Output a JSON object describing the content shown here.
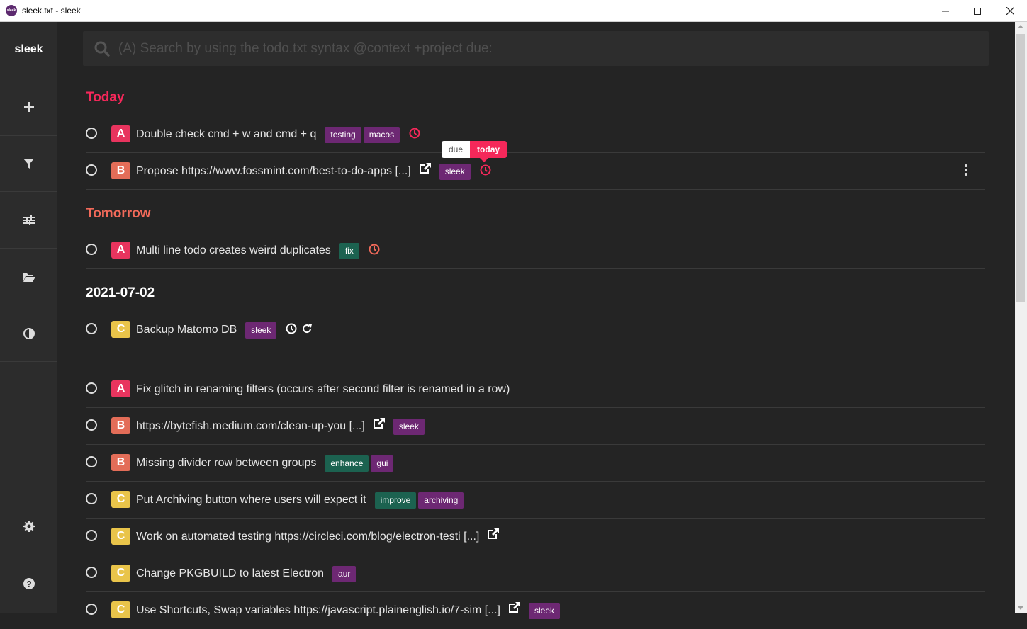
{
  "window": {
    "title": "sleek.txt - sleek",
    "app_icon_text": "sleek"
  },
  "sidebar": {
    "logo": "sleek",
    "items": [
      {
        "icon": "plus-icon"
      },
      {
        "icon": "filter-icon"
      },
      {
        "icon": "sliders-icon"
      },
      {
        "icon": "folder-open-icon"
      },
      {
        "icon": "contrast-icon"
      },
      {
        "icon": "gear-icon"
      },
      {
        "icon": "help-icon"
      }
    ]
  },
  "search": {
    "placeholder": "(A) Search by using the todo.txt syntax @context +project due:",
    "value": ""
  },
  "tooltip": {
    "label": "due",
    "value": "today"
  },
  "groups": [
    {
      "title": "Today",
      "color": "#f5285a"
    },
    {
      "title": "Tomorrow",
      "color": "#f26a5a"
    },
    {
      "title": "2021-07-02",
      "color": "#ffffff"
    }
  ],
  "priority_colors": {
    "A": "#e8345e",
    "B": "#e36d58",
    "C": "#e9c44a"
  },
  "todos": [
    {
      "priority": "A",
      "text": "Double check cmd + w and cmd + q",
      "tags": [
        "testing",
        "macos"
      ],
      "due": true
    },
    {
      "priority": "B",
      "text": "Propose https://www.fossmint.com/best-to-do-apps [...]",
      "link": true,
      "tags": [
        "sleek"
      ],
      "due": true
    },
    {
      "priority": "A",
      "text": "Multi line todo creates weird duplicates",
      "tags": [
        "fix"
      ],
      "due": true
    },
    {
      "priority": "C",
      "text": "Backup Matomo DB",
      "tags": [
        "sleek"
      ],
      "due": true,
      "recurring": true
    },
    {
      "priority": "A",
      "text": "Fix glitch in renaming filters (occurs after second filter is renamed in a row)",
      "tags": []
    },
    {
      "priority": "B",
      "text": "https://bytefish.medium.com/clean-up-you [...]",
      "link": true,
      "tags": [
        "sleek"
      ]
    },
    {
      "priority": "B",
      "text": "Missing divider row between groups",
      "tags": [
        "enhance",
        "gui"
      ]
    },
    {
      "priority": "C",
      "text": "Put Archiving button where users will expect it",
      "tags": [
        "improve",
        "archiving"
      ]
    },
    {
      "priority": "C",
      "text": "Work on automated testing https://circleci.com/blog/electron-testi [...]",
      "link": true,
      "tags": []
    },
    {
      "priority": "C",
      "text": "Change PKGBUILD to latest Electron",
      "tags": [
        "aur"
      ]
    },
    {
      "priority": "C",
      "text": "Use Shortcuts, Swap variables https://javascript.plainenglish.io/7-sim [...]",
      "link": true,
      "tags": [
        "sleek"
      ]
    }
  ]
}
